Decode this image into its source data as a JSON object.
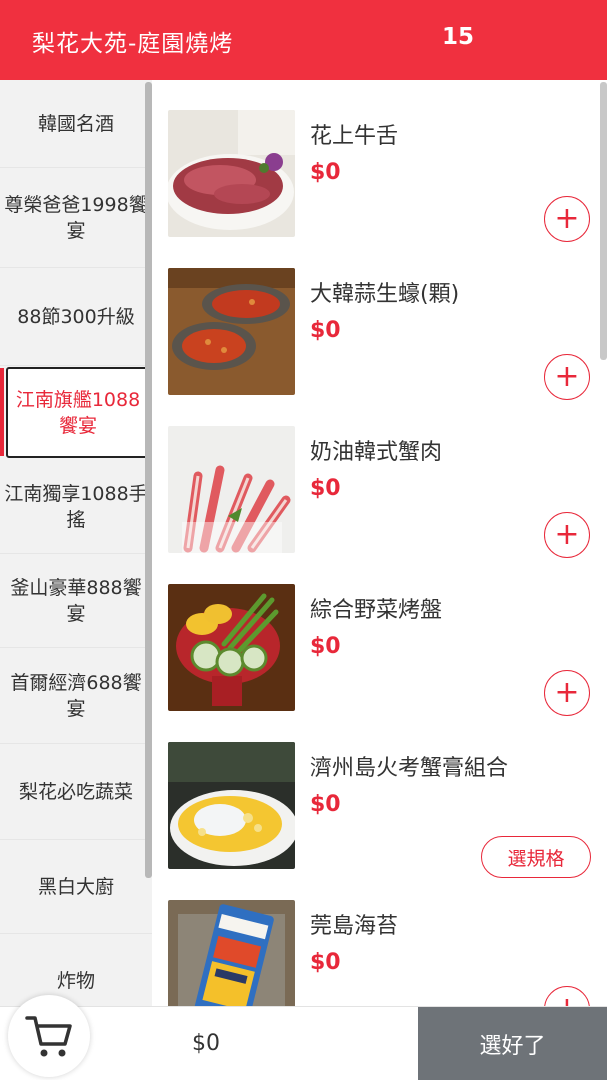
{
  "header": {
    "title": "梨花大苑-庭園燒烤",
    "table_no": "15"
  },
  "sidebar": {
    "items": [
      {
        "label": "韓國名酒"
      },
      {
        "label": "尊榮爸爸1998饗宴"
      },
      {
        "label": "88節300升級"
      },
      {
        "label": "江南旗艦1088饗宴",
        "active": true
      },
      {
        "label": "江南獨享1088手搖"
      },
      {
        "label": "釜山豪華888饗宴"
      },
      {
        "label": "首爾經濟688饗宴"
      },
      {
        "label": "梨花必吃蔬菜"
      },
      {
        "label": "黑白大廚"
      },
      {
        "label": "炸物"
      }
    ]
  },
  "menu": {
    "items": [
      {
        "name": "花上牛舌",
        "price": "$0",
        "action": "+"
      },
      {
        "name": "大韓蒜生蠔(顆)",
        "price": "$0",
        "action": "+"
      },
      {
        "name": "奶油韓式蟹肉",
        "price": "$0",
        "action": "+"
      },
      {
        "name": "綜合野菜烤盤",
        "price": "$0",
        "action": "+"
      },
      {
        "name": "濟州島火考蟹膏組合",
        "price": "$0",
        "action": "選規格"
      },
      {
        "name": "莞島海苔",
        "price": "$0",
        "action": "+"
      }
    ]
  },
  "footer": {
    "total": "$0",
    "done_label": "選好了"
  },
  "colors": {
    "accent": "#f0303f",
    "price": "#e8283a",
    "done_bg": "#6e7378"
  },
  "icons": {
    "cart": "cart-icon",
    "add": "plus-icon"
  }
}
